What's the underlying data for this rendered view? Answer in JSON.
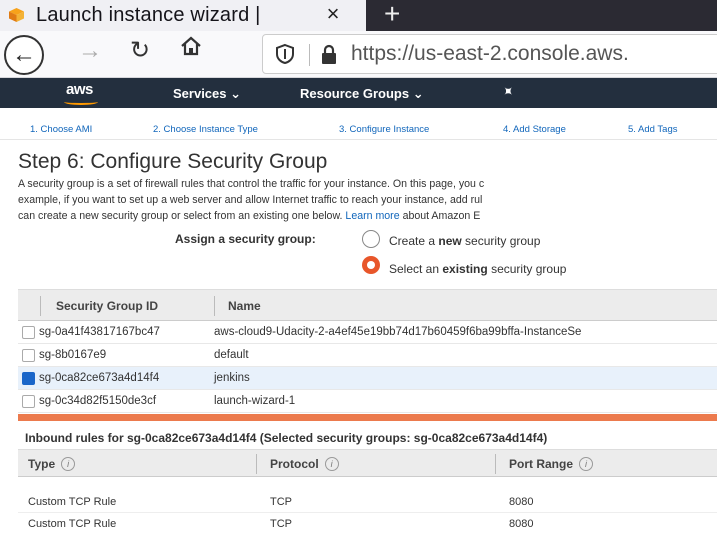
{
  "browser": {
    "tab_title": "Launch instance wizard |",
    "tab_close": "×",
    "new_tab": "+",
    "url": "https://us-east-2.console.aws."
  },
  "aws_header": {
    "logo": "aws",
    "services": "Services",
    "resource_groups": "Resource Groups",
    "caret": "⌄"
  },
  "steps": [
    "1. Choose AMI",
    "2. Choose Instance Type",
    "3. Configure Instance",
    "4. Add Storage",
    "5. Add Tags"
  ],
  "page": {
    "title": "Step 6: Configure Security Group",
    "desc_line1": "A security group is a set of firewall rules that control the traffic for your instance. On this page, you c",
    "desc_line2": "example, if you want to set up a web server and allow Internet traffic to reach your instance, add rul",
    "desc_line3_a": "can create a new security group or select from an existing one below.",
    "desc_line3_link": "Learn more",
    "desc_line3_b": "about Amazon E"
  },
  "assign": {
    "label": "Assign a security group:",
    "option_new_pre": "Create a ",
    "option_new_bold": "new",
    "option_new_post": " security group",
    "option_existing_pre": "Select an ",
    "option_existing_bold": "existing",
    "option_existing_post": " security group",
    "selected": "existing"
  },
  "sg_table": {
    "headers": [
      "Security Group ID",
      "Name"
    ],
    "rows": [
      {
        "id": "sg-0a41f43817167bc47",
        "name": "aws-cloud9-Udacity-2-a4ef45e19bb74d17b60459f6ba99bffa-InstanceSe",
        "selected": false
      },
      {
        "id": "sg-8b0167e9",
        "name": "default",
        "selected": false
      },
      {
        "id": "sg-0ca82ce673a4d14f4",
        "name": "jenkins",
        "selected": true
      },
      {
        "id": "sg-0c34d82f5150de3cf",
        "name": "launch-wizard-1",
        "selected": false
      }
    ]
  },
  "inbound": {
    "title": "Inbound rules for sg-0ca82ce673a4d14f4 (Selected security groups: sg-0ca82ce673a4d14f4)",
    "headers": [
      "Type",
      "Protocol",
      "Port Range"
    ],
    "rows": [
      {
        "type": "Custom TCP Rule",
        "protocol": "TCP",
        "port": "8080"
      },
      {
        "type": "Custom TCP Rule",
        "protocol": "TCP",
        "port": "8080"
      }
    ]
  },
  "colors": {
    "aws_header": "#232f3e",
    "accent_orange": "#ec7a4d",
    "link_blue": "#1166bb"
  }
}
